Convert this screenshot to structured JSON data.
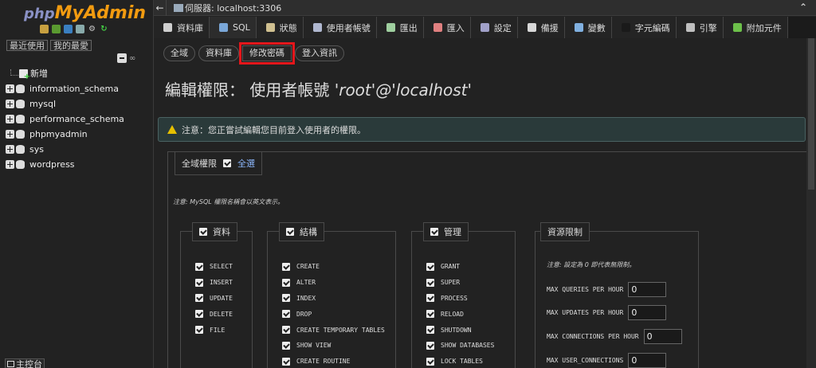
{
  "nav": {
    "logo": {
      "php": "php",
      "my": "My",
      "admin": "Admin"
    },
    "tabs": [
      "最近使用",
      "我的最愛"
    ],
    "new_label": "新增",
    "databases": [
      "information_schema",
      "mysql",
      "performance_schema",
      "phpmyadmin",
      "sys",
      "wordpress"
    ]
  },
  "serverbar": {
    "back": "←",
    "text": "伺服器: localhost:3306",
    "collapse": "⌃"
  },
  "menu": [
    {
      "label": "資料庫",
      "icon_color": "#cfcfcf",
      "icon": "database-icon"
    },
    {
      "label": "SQL",
      "icon_color": "#7aa7d8",
      "icon": "sql-icon"
    },
    {
      "label": "狀態",
      "icon_color": "#d0c090",
      "icon": "status-icon"
    },
    {
      "label": "使用者帳號",
      "icon_color": "#b0b8d0",
      "icon": "users-icon"
    },
    {
      "label": "匯出",
      "icon_color": "#9fcf9f",
      "icon": "export-icon"
    },
    {
      "label": "匯入",
      "icon_color": "#e08080",
      "icon": "import-icon"
    },
    {
      "label": "設定",
      "icon_color": "#a0a0c8",
      "icon": "wrench-icon"
    },
    {
      "label": "備援",
      "icon_color": "#d8d8d8",
      "icon": "replication-icon"
    },
    {
      "label": "變數",
      "icon_color": "#80b0e0",
      "icon": "variables-icon"
    },
    {
      "label": "字元編碼",
      "icon_color": "#1a1a1a",
      "icon": "charset-icon"
    },
    {
      "label": "引擎",
      "icon_color": "#c0c0c0",
      "icon": "engine-icon"
    },
    {
      "label": "附加元件",
      "icon_color": "#6cc04a",
      "icon": "plugin-icon"
    }
  ],
  "subtabs": [
    "全域",
    "資料庫",
    "修改密碼",
    "登入資訊"
  ],
  "title": {
    "prefix": "編輯權限： 使用者帳號 ",
    "account": "'root'@'localhost'"
  },
  "notice": "注意：您正嘗試編輯您目前登入使用者的權限。",
  "global": {
    "legend": "全域權限",
    "select_all": "全選",
    "note": "注意: MySQL 權限名稱會以英文表示。"
  },
  "groups": {
    "data": {
      "label": "資料",
      "privs": [
        "SELECT",
        "INSERT",
        "UPDATE",
        "DELETE",
        "FILE"
      ]
    },
    "structure": {
      "label": "結構",
      "privs": [
        "CREATE",
        "ALTER",
        "INDEX",
        "DROP",
        "CREATE TEMPORARY TABLES",
        "SHOW VIEW",
        "CREATE ROUTINE"
      ]
    },
    "admin": {
      "label": "管理",
      "privs": [
        "GRANT",
        "SUPER",
        "PROCESS",
        "RELOAD",
        "SHUTDOWN",
        "SHOW DATABASES",
        "LOCK TABLES"
      ]
    },
    "limits": {
      "label": "資源限制",
      "note": "注意: 設定為 0 即代表無限制。",
      "items": [
        {
          "label": "MAX QUERIES PER HOUR",
          "value": "0"
        },
        {
          "label": "MAX UPDATES PER HOUR",
          "value": "0"
        },
        {
          "label": "MAX CONNECTIONS PER HOUR",
          "value": "0"
        },
        {
          "label": "MAX USER_CONNECTIONS",
          "value": "0"
        }
      ]
    }
  },
  "console": "主控台"
}
